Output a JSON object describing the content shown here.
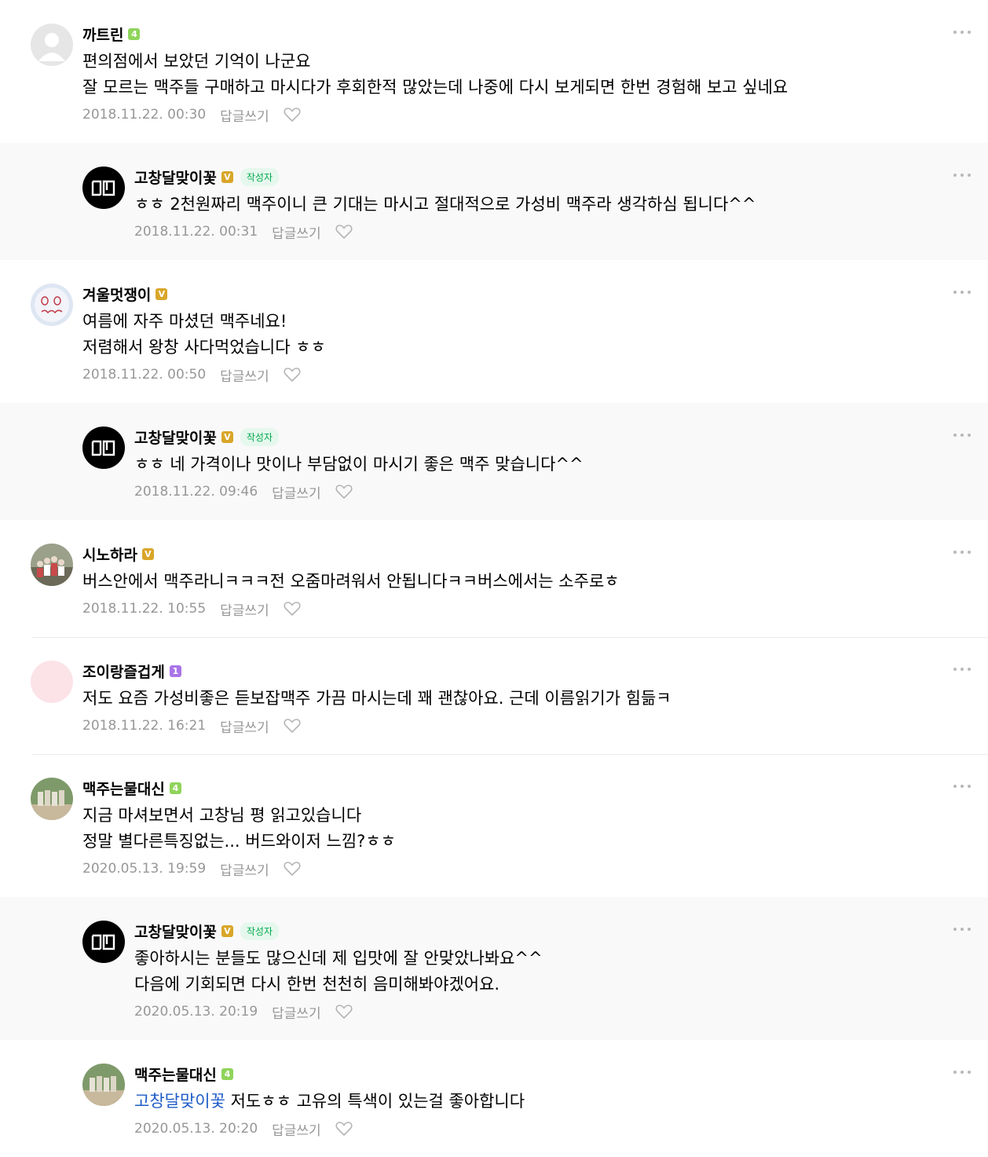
{
  "comments": [
    {
      "nickname": "까트린",
      "badge": {
        "text": "4",
        "color": "#8fd45b"
      },
      "is_author": false,
      "avatar_icon": "default-profile-icon",
      "lines": [
        "편의점에서 보았던 기억이 나군요",
        "잘 모르는 맥주들 구매하고 마시다가 후회한적 많았는데 나중에 다시 보게되면 한번 경험해 보고 싶네요"
      ],
      "date": "2018.11.22. 00:30",
      "reply_label": "답글쓰기"
    },
    {
      "nickname": "고창달맞이꽃",
      "badge": {
        "text": "V",
        "color": "#d9a629"
      },
      "is_author": true,
      "author_label": "작성자",
      "avatar_icon": "gd-logo-avatar-icon",
      "lines": [
        "ㅎㅎ 2천원짜리 맥주이니 큰 기대는 마시고 절대적으로 가성비 맥주라 생각하심 됩니다^^"
      ],
      "date": "2018.11.22. 00:31",
      "reply_label": "답글쓰기"
    },
    {
      "nickname": "겨울멋쟁이",
      "badge": {
        "text": "V",
        "color": "#d9a629"
      },
      "is_author": false,
      "avatar_icon": "doodle-face-avatar-icon",
      "lines": [
        "여름에 자주 마셨던 맥주네요!",
        "저렴해서 왕창 사다먹었습니다 ㅎㅎ"
      ],
      "date": "2018.11.22. 00:50",
      "reply_label": "답글쓰기"
    },
    {
      "nickname": "고창달맞이꽃",
      "badge": {
        "text": "V",
        "color": "#d9a629"
      },
      "is_author": true,
      "author_label": "작성자",
      "avatar_icon": "gd-logo-avatar-icon",
      "lines": [
        "ㅎㅎ 네 가격이나 맛이나 부담없이 마시기 좋은 맥주 맞습니다^^"
      ],
      "date": "2018.11.22. 09:46",
      "reply_label": "답글쓰기"
    },
    {
      "nickname": "시노하라",
      "badge": {
        "text": "V",
        "color": "#d9a629"
      },
      "is_author": false,
      "avatar_icon": "group-photo-avatar-icon",
      "lines": [
        "버스안에서 맥주라니ㅋㅋㅋ전 오줌마려워서 안됩니다ㅋㅋ버스에서는 소주로ㅎ"
      ],
      "date": "2018.11.22. 10:55",
      "reply_label": "답글쓰기"
    },
    {
      "nickname": "조이랑즐겁게",
      "badge": {
        "text": "1",
        "color": "#a974e8"
      },
      "is_author": false,
      "avatar_icon": "pink-circle-avatar-icon",
      "lines": [
        "저도 요즘 가성비좋은 듣보잡맥주 가끔 마시는데 꽤 괜찮아요. 근데 이름읽기가 힘듦ㅋ"
      ],
      "date": "2018.11.22. 16:21",
      "reply_label": "답글쓰기"
    },
    {
      "nickname": "맥주는물대신",
      "badge": {
        "text": "4",
        "color": "#8fd45b"
      },
      "is_author": false,
      "avatar_icon": "beer-glasses-avatar-icon",
      "lines": [
        "지금 마셔보면서 고창님 평 읽고있습니다",
        "정말 별다른특징없는... 버드와이저 느낌?ㅎㅎ"
      ],
      "date": "2020.05.13. 19:59",
      "reply_label": "답글쓰기"
    },
    {
      "nickname": "고창달맞이꽃",
      "badge": {
        "text": "V",
        "color": "#d9a629"
      },
      "is_author": true,
      "author_label": "작성자",
      "avatar_icon": "gd-logo-avatar-icon",
      "lines": [
        "좋아하시는 분들도 많으신데 제 입맛에 잘 안맞았나봐요^^",
        "다음에 기회되면 다시 한번 천천히 음미해봐야겠어요."
      ],
      "date": "2020.05.13. 20:19",
      "reply_label": "답글쓰기"
    },
    {
      "nickname": "맥주는물대신",
      "badge": {
        "text": "4",
        "color": "#8fd45b"
      },
      "is_author": false,
      "avatar_icon": "beer-glasses-avatar-icon",
      "mention": "고창달맞이꽃",
      "lines": [
        "저도ㅎㅎ 고유의 특색이 있는걸 좋아합니다"
      ],
      "date": "2020.05.13. 20:20",
      "reply_label": "답글쓰기"
    }
  ],
  "colors": {
    "reply_background": "#f9f9fa",
    "meta_text": "#979797",
    "author_tag": "#03a94d",
    "mention": "#1e5cc7"
  }
}
